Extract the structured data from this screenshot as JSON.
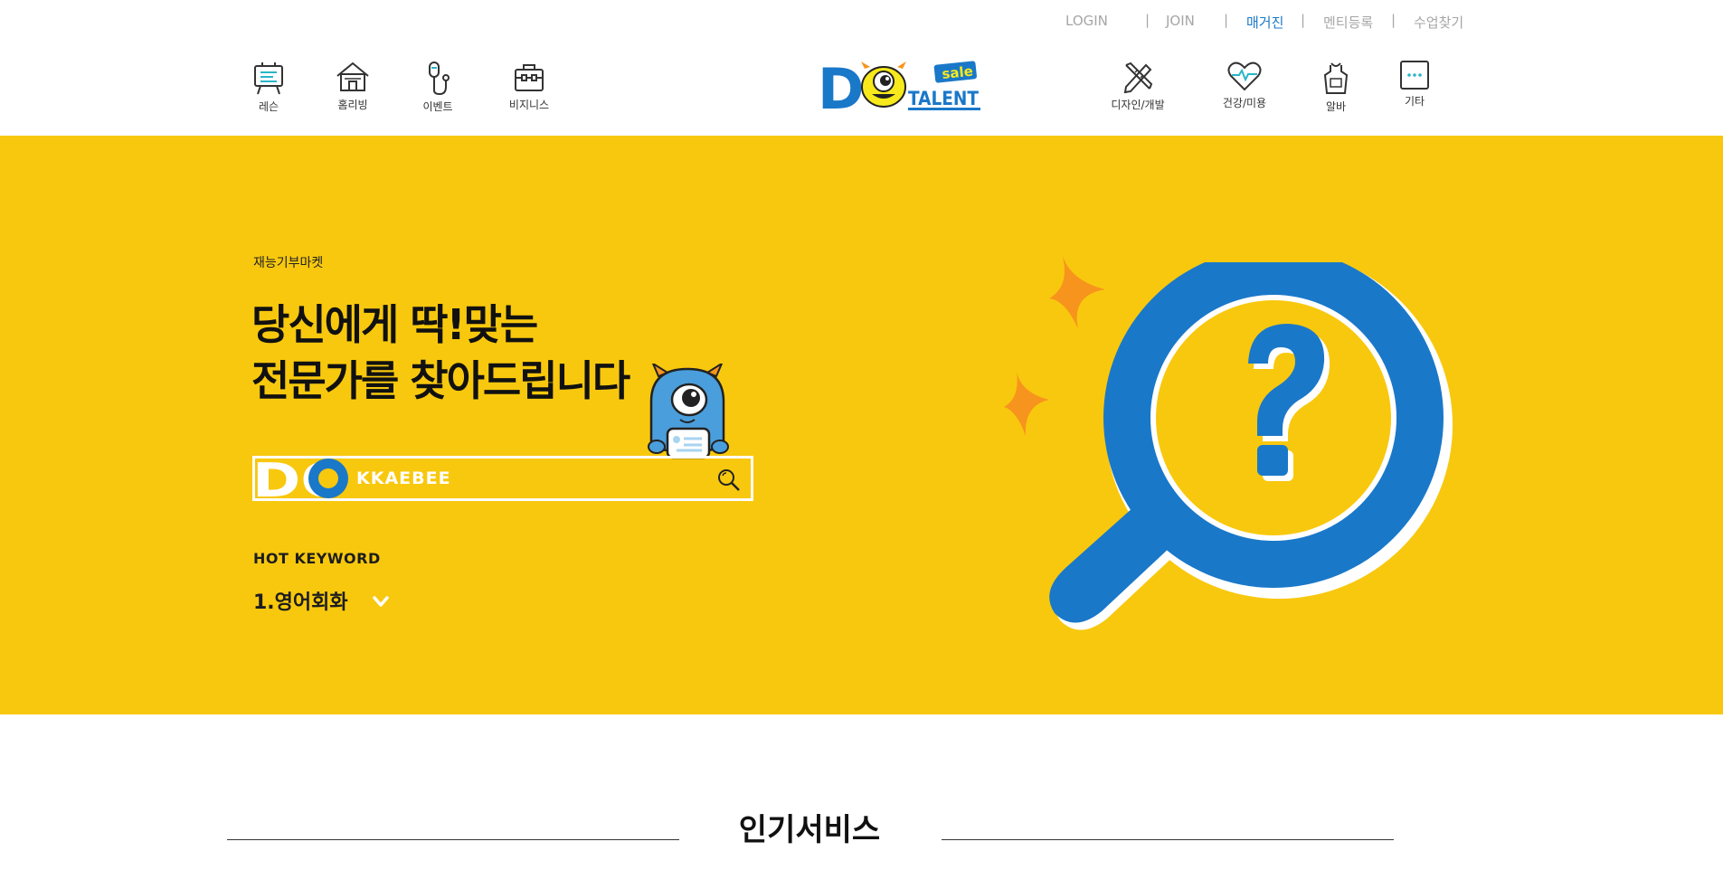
{
  "top_links": {
    "login": "LOGIN",
    "join": "JOIN",
    "magazine": "매거진",
    "mentor": "멘티등록",
    "find_class": "수업찾기",
    "separator": "|"
  },
  "categories_left": [
    {
      "label": "레슨",
      "icon": "easel-icon"
    },
    {
      "label": "홈리빙",
      "icon": "house-icon"
    },
    {
      "label": "이벤트",
      "icon": "microphone-icon"
    },
    {
      "label": "비지니스",
      "icon": "briefcase-icon"
    }
  ],
  "categories_right": [
    {
      "label": "디자인/개발",
      "icon": "pencil-ruler-icon"
    },
    {
      "label": "건강/미용",
      "icon": "heart-pulse-icon"
    },
    {
      "label": "알바",
      "icon": "apron-icon"
    },
    {
      "label": "기타",
      "icon": "more-icon"
    }
  ],
  "logo": {
    "big_letter": "D",
    "word": "TALENT",
    "tag": "sale"
  },
  "hero": {
    "eyebrow": "재능기부마켓",
    "title_line1": "당신에게 딱!맞는",
    "title_line2": "전문가를 찾아드립니다",
    "search_brand": "DO",
    "search_placeholder": "KKAEBEE",
    "hot_label": "HOT KEYWORD",
    "hot_item": "1.영어회화"
  },
  "section": {
    "title": "인기서비스"
  },
  "colors": {
    "hero_bg": "#f8c80e",
    "brand_blue": "#1a78c9",
    "accent_orange": "#f7941d",
    "text_dark": "#111111",
    "util_gray": "#a6a6a6"
  }
}
